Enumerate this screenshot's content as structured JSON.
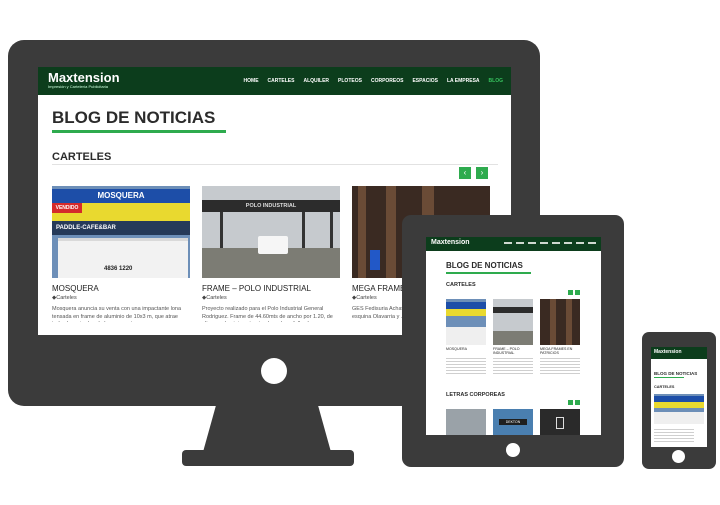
{
  "site": {
    "logo": "Maxtension",
    "logo_tagline": "Impresión y Cartelería Publicitaria"
  },
  "nav": {
    "items": [
      "HOME",
      "CARTELES",
      "ALQUILER",
      "PLOTEOS",
      "CORPOREOS",
      "ESPACIOS",
      "LA EMPRESA",
      "BLOG"
    ],
    "active_item": "BLOG"
  },
  "page": {
    "title": "BLOG DE NOTICIAS",
    "section_title": "CARTELES",
    "section_title_2": "LETRAS CORPOREAS",
    "prev_arrow": "‹",
    "next_arrow": "›"
  },
  "posts": [
    {
      "title": "MOSQUERA",
      "category": "Carteles",
      "excerpt": "Mosquera anuncia su venta con una impactante lona tensada en frame de aluminio de 10x3 m, que atrae todas las miradas de los paseantes.",
      "photo_sign": "MOSQUERA",
      "photo_sub": "VENDIDO",
      "photo_bar": "PADDLE-CAFE&BAR",
      "photo_phone": "4836 1220"
    },
    {
      "title": "FRAME – POLO INDUSTRIAL",
      "category": "Carteles",
      "excerpt": "Proyecto realizado para el Polo Industrial General Rodriguez. Frame de 44.60mts de ancho por 1.20, de alto, en aluminio estructural con lona full col ...",
      "photo_sign": "POLO INDUSTRIAL"
    },
    {
      "title": "MEGA FRAMES",
      "category": "Carteles",
      "excerpt": "GES Fedisuria Achaval Rodriguez los Mega frames 1 esquina Olavarria y ..."
    }
  ],
  "tablet": {
    "posts": [
      "MOSQUERA",
      "FRAME – POLO INDUSTRIAL",
      "MEGA FRAMES EN PATRICIOS"
    ],
    "bottom_labels": [
      "DEKTON"
    ]
  },
  "colors": {
    "nav_bg": "#0c3d1c",
    "accent": "#2eab4e",
    "device": "#3b3b3b"
  }
}
